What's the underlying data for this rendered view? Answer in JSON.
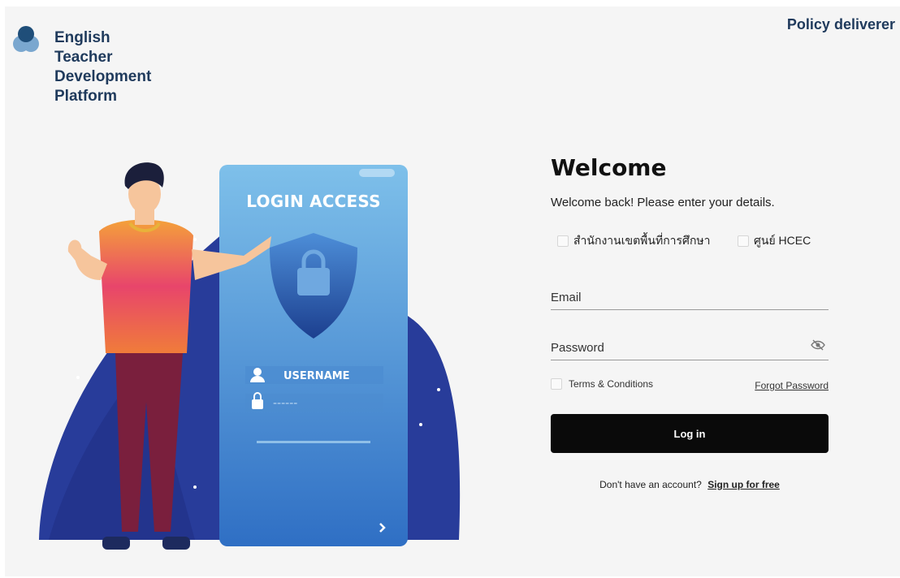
{
  "brand": {
    "logo_icon": "overlapping-circles-logo-icon",
    "name": "English\nTeacher\nDevelopment\nPlatform",
    "colors": {
      "primary": "#1f3a5c",
      "logo_dark": "#1f4e79",
      "logo_light": "#7aa7cf"
    }
  },
  "header": {
    "role_label": "Policy deliverer"
  },
  "illustration": {
    "panel_title": "LOGIN ACCESS",
    "username_label": "USERNAME",
    "password_mask": "------",
    "icons": [
      "shield-lock-icon",
      "user-icon",
      "lock-icon",
      "chevron-right-icon"
    ]
  },
  "form": {
    "title": "Welcome",
    "subtitle": "Welcome back! Please enter your details.",
    "options": [
      {
        "label": "สำนักงานเขตพื้นที่การศึกษา"
      },
      {
        "label": "ศูนย์ HCEC"
      }
    ],
    "email_placeholder": "Email",
    "password_placeholder": "Password",
    "password_toggle_icon": "eye-off-icon",
    "terms_label": "Terms & Conditions",
    "forgot_label": "Forgot Password",
    "login_label": "Log in",
    "signup_prompt": "Don't have an account?",
    "signup_link": "Sign up for free",
    "button_color": "#0a0a0a"
  }
}
